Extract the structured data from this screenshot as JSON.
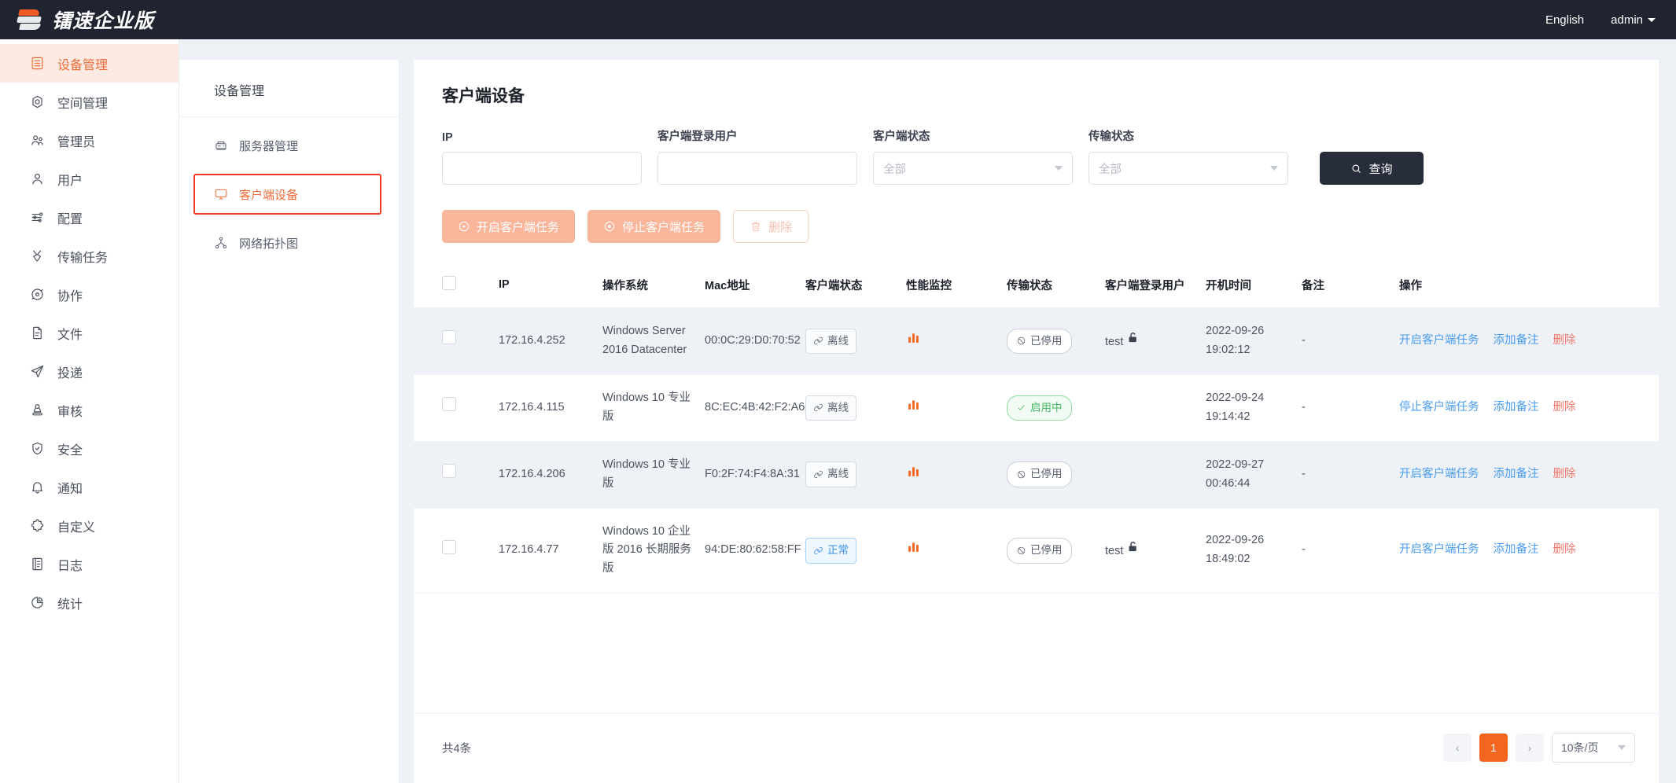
{
  "header": {
    "logo_text": "镭速企业版",
    "language": "English",
    "user": "admin"
  },
  "sidebar": {
    "items": [
      {
        "label": "设备管理",
        "icon": "device-icon",
        "active": true
      },
      {
        "label": "空间管理",
        "icon": "space-icon",
        "active": false
      },
      {
        "label": "管理员",
        "icon": "admins-icon",
        "active": false
      },
      {
        "label": "用户",
        "icon": "user-icon",
        "active": false
      },
      {
        "label": "配置",
        "icon": "settings-sliders-icon",
        "active": false
      },
      {
        "label": "传输任务",
        "icon": "transfer-icon",
        "active": false
      },
      {
        "label": "协作",
        "icon": "collaborate-icon",
        "active": false
      },
      {
        "label": "文件",
        "icon": "file-icon",
        "active": false
      },
      {
        "label": "投递",
        "icon": "send-icon",
        "active": false
      },
      {
        "label": "审核",
        "icon": "stamp-icon",
        "active": false
      },
      {
        "label": "安全",
        "icon": "shield-check-icon",
        "active": false
      },
      {
        "label": "通知",
        "icon": "bell-icon",
        "active": false
      },
      {
        "label": "自定义",
        "icon": "puzzle-icon",
        "active": false
      },
      {
        "label": "日志",
        "icon": "log-icon",
        "active": false
      },
      {
        "label": "统计",
        "icon": "pie-chart-icon",
        "active": false
      }
    ]
  },
  "subnav": {
    "title": "设备管理",
    "items": [
      {
        "label": "服务器管理",
        "icon": "server-icon",
        "selected": false
      },
      {
        "label": "客户端设备",
        "icon": "monitor-icon",
        "selected": true
      },
      {
        "label": "网络拓扑图",
        "icon": "topology-icon",
        "selected": false
      }
    ]
  },
  "main": {
    "page_title": "客户端设备",
    "filters": [
      {
        "label": "IP",
        "type": "input",
        "value": "",
        "placeholder": ""
      },
      {
        "label": "客户端登录用户",
        "type": "input",
        "value": "",
        "placeholder": ""
      },
      {
        "label": "客户端状态",
        "type": "select",
        "value": "全部"
      },
      {
        "label": "传输状态",
        "type": "select",
        "value": "全部"
      }
    ],
    "query_button": "查询",
    "actions": [
      {
        "label": "开启客户端任务",
        "icon": "play-circle-icon",
        "style": "primary-dis"
      },
      {
        "label": "停止客户端任务",
        "icon": "stop-circle-icon",
        "style": "primary-dis"
      },
      {
        "label": "删除",
        "icon": "trash-icon",
        "style": "ghost-dis"
      }
    ],
    "table": {
      "columns": [
        "IP",
        "操作系统",
        "Mac地址",
        "客户端状态",
        "性能监控",
        "传输状态",
        "客户端登录用户",
        "开机时间",
        "备注",
        "操作"
      ],
      "rows": [
        {
          "ip": "172.16.4.252",
          "os": "Windows Server 2016 Datacenter",
          "mac": "00:0C:29:D0:70:52",
          "client_status": "离线",
          "client_status_type": "offline",
          "transfer_status": "已停用",
          "transfer_status_type": "disabled",
          "login_user": "test",
          "has_lock": true,
          "boot_time": "2022-09-26 19:02:12",
          "remark": "-",
          "ops": [
            "开启客户端任务",
            "添加备注",
            "删除"
          ]
        },
        {
          "ip": "172.16.4.115",
          "os": "Windows 10 专业版",
          "mac": "8C:EC:4B:42:F2:A6",
          "client_status": "离线",
          "client_status_type": "offline",
          "transfer_status": "启用中",
          "transfer_status_type": "active",
          "login_user": "",
          "has_lock": false,
          "boot_time": "2022-09-24 19:14:42",
          "remark": "-",
          "ops": [
            "停止客户端任务",
            "添加备注",
            "删除"
          ]
        },
        {
          "ip": "172.16.4.206",
          "os": "Windows 10 专业版",
          "mac": "F0:2F:74:F4:8A:31",
          "client_status": "离线",
          "client_status_type": "offline",
          "transfer_status": "已停用",
          "transfer_status_type": "disabled",
          "login_user": "",
          "has_lock": false,
          "boot_time": "2022-09-27 00:46:44",
          "remark": "-",
          "ops": [
            "开启客户端任务",
            "添加备注",
            "删除"
          ]
        },
        {
          "ip": "172.16.4.77",
          "os": "Windows 10 企业版 2016 长期服务版",
          "mac": "94:DE:80:62:58:FF",
          "client_status": "正常",
          "client_status_type": "online",
          "transfer_status": "已停用",
          "transfer_status_type": "disabled",
          "login_user": "test",
          "has_lock": true,
          "boot_time": "2022-09-26 18:49:02",
          "remark": "-",
          "ops": [
            "开启客户端任务",
            "添加备注",
            "删除"
          ]
        }
      ]
    },
    "footer": {
      "total": "共4条",
      "prev": "‹",
      "next": "›",
      "pages": [
        "1"
      ],
      "current_page": "1",
      "page_size": "10条/页"
    }
  },
  "colors": {
    "accent": "#f4651f",
    "link": "#4a9cf0",
    "danger": "#f4786a",
    "topbar": "#1f2430",
    "active_bg": "#fdeae2",
    "select_border": "#ef3b24"
  }
}
